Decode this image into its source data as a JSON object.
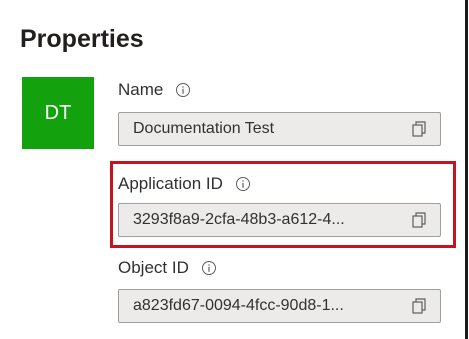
{
  "panel": {
    "title": "Properties",
    "avatar_initials": "DT",
    "avatar_color": "#13a10e"
  },
  "fields": {
    "name": {
      "label": "Name",
      "value": "Documentation Test",
      "icon": "info-icon",
      "action_icon": "copy-icon"
    },
    "application_id": {
      "label": "Application ID",
      "value": "3293f8a9-2cfa-48b3-a612-4...",
      "icon": "info-icon",
      "action_icon": "copy-icon"
    },
    "object_id": {
      "label": "Object ID",
      "value": "a823fd67-0094-4fcc-90d8-1...",
      "icon": "info-icon",
      "action_icon": "copy-icon"
    }
  },
  "highlight_color": "#c4141f"
}
